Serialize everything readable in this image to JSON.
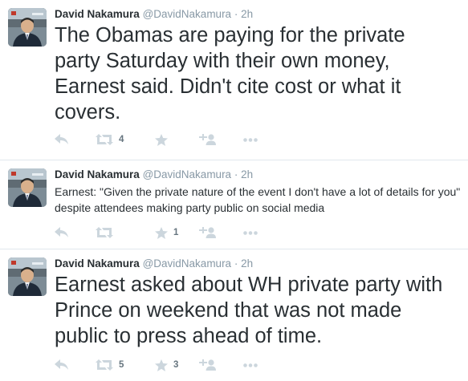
{
  "tweets": [
    {
      "fullname": "David Nakamura",
      "username": "@DavidNakamura",
      "separator": "·",
      "time": "2h",
      "text": "The Obamas are paying for the private party Saturday with their own money, Earnest said. Didn't cite cost or what it covers.",
      "retweets": "4",
      "favorites": ""
    },
    {
      "fullname": "David Nakamura",
      "username": "@DavidNakamura",
      "separator": "·",
      "time": "2h",
      "text": "Earnest: \"Given the private nature of the event I don't have a lot of details for you\" despite attendees making party public on social media",
      "retweets": "",
      "favorites": "1"
    },
    {
      "fullname": "David Nakamura",
      "username": "@DavidNakamura",
      "separator": "·",
      "time": "2h",
      "text": "Earnest asked about WH private party with Prince on weekend that was not made public to press ahead of time.",
      "retweets": "5",
      "favorites": "3"
    }
  ],
  "icons": {
    "reply": "reply-icon",
    "retweet": "retweet-icon",
    "favorite": "star-icon",
    "follow": "follow-icon",
    "more": "more-icon"
  },
  "colors": {
    "text": "#292f33",
    "meta": "#8899a6",
    "action_icon": "#ccd6dd",
    "count": "#66757f",
    "divider": "#e1e8ed"
  }
}
